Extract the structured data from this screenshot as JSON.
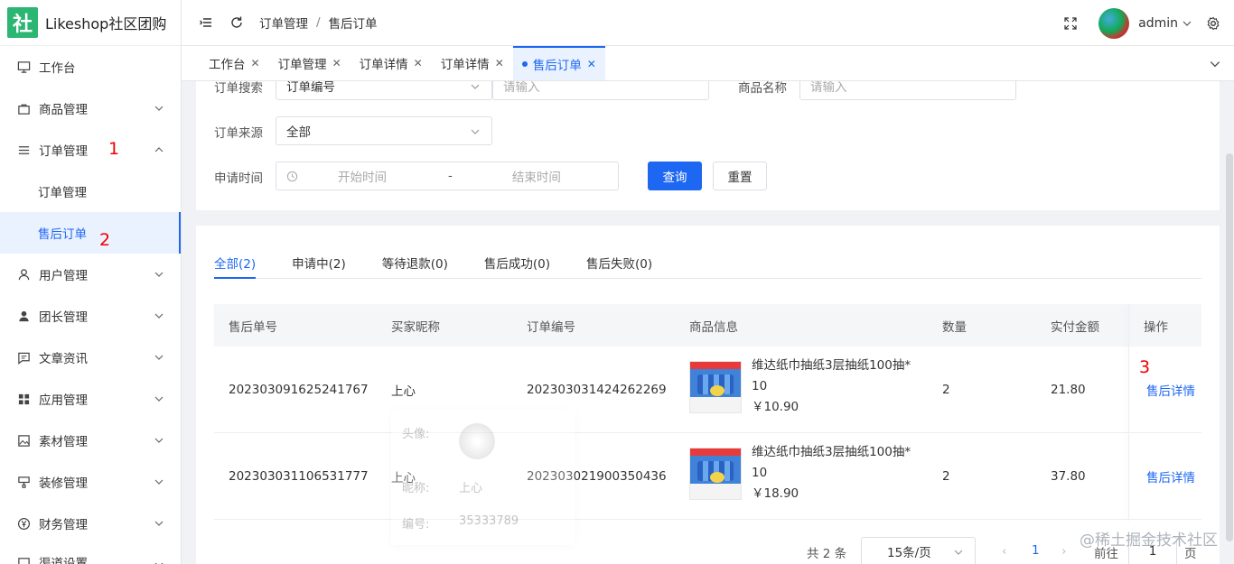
{
  "app": {
    "logo_glyph": "社",
    "name": "Likeshop社区团购",
    "brand_color": "#2bb673",
    "accent_color": "#1d67f2"
  },
  "sidebar": {
    "items": [
      {
        "label": "工作台",
        "icon": "monitor-icon"
      },
      {
        "label": "商品管理",
        "icon": "bag-icon"
      },
      {
        "label": "订单管理",
        "icon": "list-icon",
        "expanded": true,
        "annotation": "1"
      },
      {
        "label": "订单管理",
        "sub": true
      },
      {
        "label": "售后订单",
        "sub": true,
        "active": true,
        "annotation": "2"
      },
      {
        "label": "用户管理",
        "icon": "user-icon"
      },
      {
        "label": "团长管理",
        "icon": "person-icon"
      },
      {
        "label": "文章资讯",
        "icon": "message-icon"
      },
      {
        "label": "应用管理",
        "icon": "grid-icon"
      },
      {
        "label": "素材管理",
        "icon": "image-icon"
      },
      {
        "label": "装修管理",
        "icon": "brush-icon"
      },
      {
        "label": "财务管理",
        "icon": "yen-icon"
      },
      {
        "label": "渠道设置",
        "icon": "channel-icon"
      }
    ]
  },
  "header": {
    "breadcrumb": [
      "订单管理",
      "售后订单"
    ],
    "username": "admin"
  },
  "page_tabs": [
    {
      "label": "工作台"
    },
    {
      "label": "订单管理"
    },
    {
      "label": "订单详情"
    },
    {
      "label": "订单详情"
    },
    {
      "label": "售后订单",
      "active": true
    }
  ],
  "filter": {
    "search_label": "订单搜索",
    "search_type": "订单编号",
    "search_placeholder": "请输入",
    "product_label": "商品名称",
    "product_placeholder": "请输入",
    "source_label": "订单来源",
    "source_value": "全部",
    "time_label": "申请时间",
    "start_placeholder": "开始时间",
    "range_sep": "-",
    "end_placeholder": "结束时间",
    "query_btn": "查询",
    "reset_btn": "重置"
  },
  "status_tabs": [
    "全部(2)",
    "申请中(2)",
    "等待退款(0)",
    "售后成功(0)",
    "售后失败(0)"
  ],
  "table": {
    "headers": [
      "售后单号",
      "买家昵称",
      "订单编号",
      "商品信息",
      "数量",
      "实付金额",
      "操作"
    ],
    "op_annotation": "3",
    "rows": [
      {
        "after_sale_no": "202303091625241767",
        "buyer": "上心",
        "order_no": "202303031424262269",
        "product_line1": "维达纸巾抽纸3层抽纸100抽*",
        "product_line2": "10",
        "price": "￥10.90",
        "qty": "2",
        "paid": "21.80",
        "action": "售后详情"
      },
      {
        "after_sale_no": "202303031106531777",
        "buyer": "上心",
        "order_no": "202303021900350436",
        "product_line1": "维达纸巾抽纸3层抽纸100抽*",
        "product_line2": "10",
        "price": "￥18.90",
        "qty": "2",
        "paid": "37.80",
        "action": "售后详情"
      }
    ]
  },
  "pagination": {
    "total": "共 2 条",
    "page_size": "15条/页",
    "current": "1",
    "goto_label": "前往",
    "goto_value": "1",
    "page_unit": "页"
  },
  "popover": {
    "avatar_label": "头像:",
    "nick_label": "昵称:",
    "nick_value": "上心",
    "id_label": "编号:",
    "id_value": "35333789"
  },
  "watermark": "@稀土掘金技术社区"
}
